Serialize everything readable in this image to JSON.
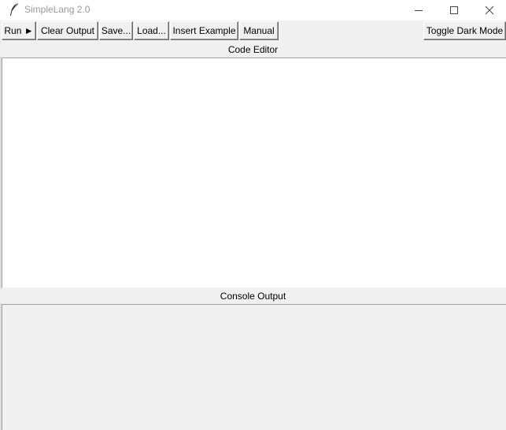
{
  "window": {
    "title": "SimpleLang 2.0",
    "icon": "feather-icon",
    "controls": [
      "minimize-icon",
      "maximize-icon",
      "close-icon"
    ]
  },
  "toolbar": {
    "run_label": "Run ►",
    "clear_output_label": "Clear Output",
    "save_label": "Save...",
    "load_label": "Load...",
    "insert_example_label": "Insert Example",
    "manual_label": "Manual",
    "toggle_dark_mode_label": "Toggle Dark Mode"
  },
  "editor": {
    "label": "Code Editor",
    "content": ""
  },
  "console": {
    "label": "Console Output",
    "content": ""
  },
  "colors": {
    "window_bg": "#f0f0f0",
    "editor_bg": "#ffffff",
    "title_text": "#999999"
  }
}
